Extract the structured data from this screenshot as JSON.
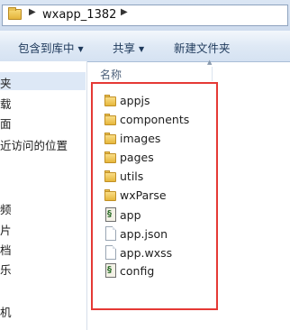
{
  "address_bar": {
    "path_segment": "wxapp_1382"
  },
  "toolbar": {
    "include_library_label": "包含到库中",
    "share_label": "共享",
    "new_folder_label": "新建文件夹"
  },
  "nav_pane": {
    "items": [
      {
        "label": "夹",
        "selected": true
      },
      {
        "label": "载"
      },
      {
        "label": "面"
      },
      {
        "label": "近访问的位置"
      },
      {
        "label": "频"
      },
      {
        "label": "片"
      },
      {
        "label": "档"
      },
      {
        "label": "乐"
      },
      {
        "label": "机"
      }
    ]
  },
  "content": {
    "column_header": "名称",
    "files": [
      {
        "name": "appjs",
        "icon": "folder-icon"
      },
      {
        "name": "components",
        "icon": "folder-icon"
      },
      {
        "name": "images",
        "icon": "folder-icon"
      },
      {
        "name": "pages",
        "icon": "folder-icon"
      },
      {
        "name": "utils",
        "icon": "folder-icon"
      },
      {
        "name": "wxParse",
        "icon": "folder-icon"
      },
      {
        "name": "app",
        "icon": "script-file-icon"
      },
      {
        "name": "app.json",
        "icon": "document-icon"
      },
      {
        "name": "app.wxss",
        "icon": "document-icon"
      },
      {
        "name": "config",
        "icon": "script-file-icon"
      }
    ]
  },
  "colors": {
    "highlight_border": "#e53935",
    "toolbar_text": "#1e395b"
  }
}
